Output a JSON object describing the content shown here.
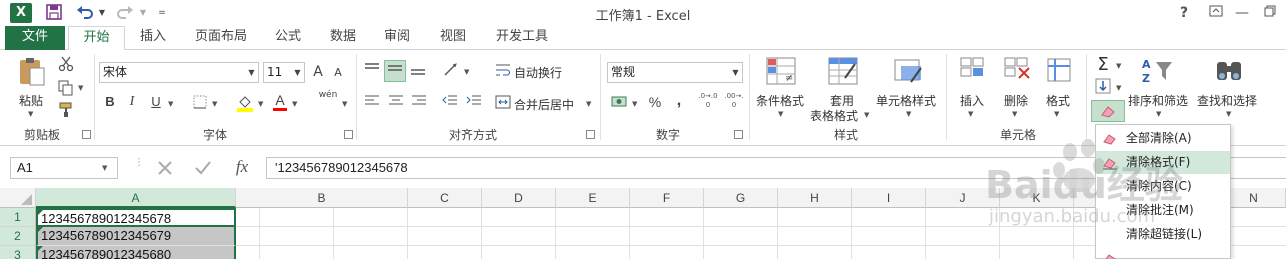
{
  "window": {
    "title": "工作簿1 - Excel",
    "help_label": "?",
    "logo_label": "X"
  },
  "tabs": [
    {
      "label": "文件"
    },
    {
      "label": "开始"
    },
    {
      "label": "插入"
    },
    {
      "label": "页面布局"
    },
    {
      "label": "公式"
    },
    {
      "label": "数据"
    },
    {
      "label": "审阅"
    },
    {
      "label": "视图"
    },
    {
      "label": "开发工具"
    }
  ],
  "ribbon": {
    "clipboard": {
      "paste_label": "粘贴",
      "group_label": "剪贴板"
    },
    "font": {
      "font_name": "宋体",
      "font_size": "11",
      "bold": "B",
      "italic": "I",
      "underline": "U",
      "grow": "A",
      "shrink": "A",
      "font_color_glyph": "A",
      "phonetic": "wén",
      "group_label": "字体"
    },
    "alignment": {
      "wrap_text": "自动换行",
      "merge_center": "合并后居中",
      "group_label": "对齐方式"
    },
    "number": {
      "format": "常规",
      "percent": "%",
      "comma": ",",
      "inc_decimal": ".0→.00",
      "dec_decimal": ".00→.0",
      "group_label": "数字"
    },
    "styles": {
      "conditional": "条件格式",
      "table_format_line1": "套用",
      "table_format_line2": "表格格式",
      "cell_styles": "单元格样式",
      "group_label": "样式"
    },
    "cells": {
      "insert": "插入",
      "delete": "删除",
      "format": "格式",
      "group_label": "单元格"
    },
    "editing": {
      "sort_filter": "排序和筛选",
      "find_select": "查找和选择",
      "sigma": "Σ"
    }
  },
  "formula_bar": {
    "name_box": "A1",
    "fx": "fx",
    "content": "'123456789012345678"
  },
  "grid": {
    "columns": [
      "A",
      "B",
      "C",
      "D",
      "E",
      "F",
      "G",
      "H",
      "I",
      "J",
      "K",
      "L",
      "M",
      "N"
    ],
    "rows": [
      {
        "num": "1",
        "a": "123456789012345678"
      },
      {
        "num": "2",
        "a": "123456789012345679"
      },
      {
        "num": "3",
        "a": "123456789012345680"
      }
    ]
  },
  "clear_menu": {
    "items": [
      {
        "label": "全部清除(A)"
      },
      {
        "label": "清除格式(F)"
      },
      {
        "label": "清除内容(C)"
      },
      {
        "label": "清除批注(M)"
      },
      {
        "label": "清除超链接(L)"
      }
    ]
  },
  "watermark": {
    "text1": "Baidu经验",
    "text2": "jingyan.baidu.com"
  },
  "colors": {
    "accent": "#217346",
    "selected_header": "#d2e8da",
    "selection_fill": "#c6c6c6"
  }
}
